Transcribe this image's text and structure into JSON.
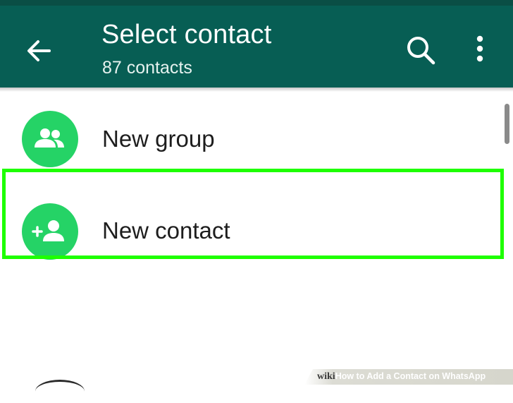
{
  "header": {
    "title": "Select contact",
    "subtitle": "87 contacts",
    "back_icon": "arrow-left-icon",
    "search_icon": "search-icon",
    "menu_icon": "more-vertical-icon"
  },
  "list": {
    "items": [
      {
        "label": "New group",
        "icon": "group-icon"
      },
      {
        "label": "New contact",
        "icon": "add-person-icon"
      }
    ]
  },
  "watermark": {
    "brand": "wiki",
    "how": "How",
    "rest": " to Add a Contact on WhatsApp"
  },
  "colors": {
    "appbar": "#075e54",
    "avatar": "#25d366",
    "highlight": "#1eff00"
  }
}
